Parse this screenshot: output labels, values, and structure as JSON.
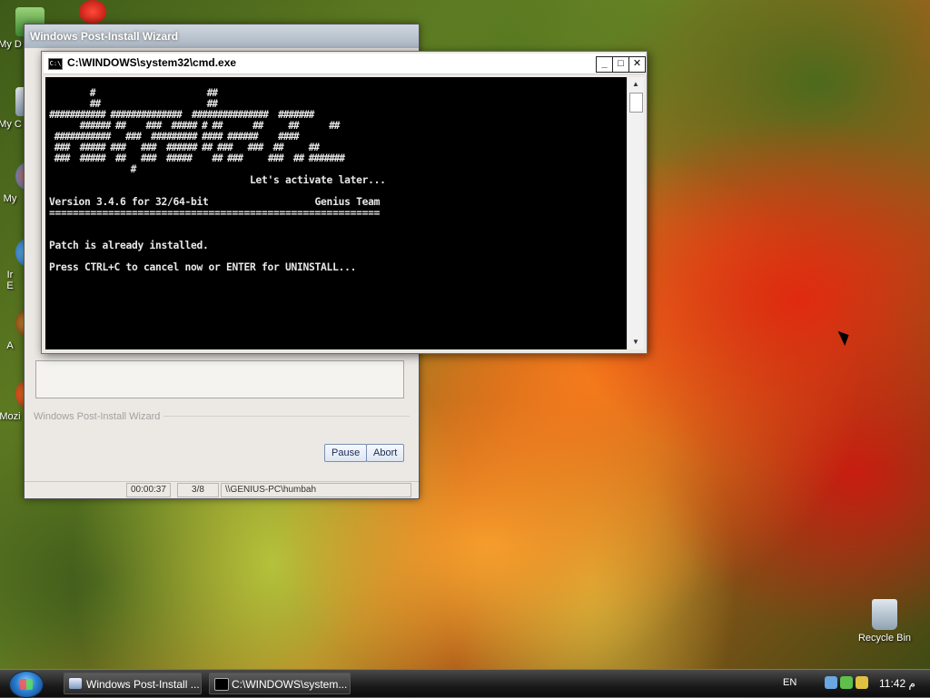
{
  "desktop": {
    "icons": [
      {
        "label": "My D",
        "icon": "my-documents-icon"
      },
      {
        "label": "My C",
        "icon": "my-computer-icon"
      },
      {
        "label": "My",
        "icon": "network-icon"
      },
      {
        "label": "Ir\nE",
        "icon": "internet-explorer-icon"
      },
      {
        "label": "A",
        "icon": "media-icon"
      },
      {
        "label": "Mozi",
        "icon": "mozilla-icon"
      }
    ],
    "recycle_bin": "Recycle Bin"
  },
  "wizard": {
    "title": "Windows Post-Install Wizard",
    "group_label": "Windows Post-Install Wizard",
    "pause_label": "Pause",
    "abort_label": "Abort",
    "status": {
      "elapsed": "00:00:37",
      "step": "3/8",
      "machine": "\\\\GENIUS-PC\\humbah"
    }
  },
  "cmd": {
    "title": "C:\\WINDOWS\\system32\\cmd.exe",
    "ascii_art": "        #                      ##\n        ##                     ##\n########### ##############  ###############  #######\n      ###### ##    ###  ##### # ##      ##     ##      ##\n ###########   ###  ######### #### ######    ####\n ###  ##### ###   ###  ###### ## ###   ###  ##     ##\n ###  #####  ##   ###  #####    ## ###     ###  ## #######\n                #",
    "lines": [
      "                                  Let's activate later...",
      "Version 3.4.6 for 32/64-bit                  Genius Team",
      "========================================================",
      "",
      "Patch is already installed.",
      "",
      "Press CTRL+C to cancel now or ENTER for UNINSTALL..."
    ]
  },
  "taskbar": {
    "tasks": [
      {
        "label": "Windows Post-Install ...",
        "icon": "wizard-icon"
      },
      {
        "label": "C:\\WINDOWS\\system...",
        "icon": "cmd-icon"
      }
    ],
    "language": "EN",
    "clock": "11:42 م"
  },
  "colors": {
    "console_bg": "#000000",
    "console_fg": "#e8e8e8",
    "taskbar": "#1a1a1a"
  }
}
